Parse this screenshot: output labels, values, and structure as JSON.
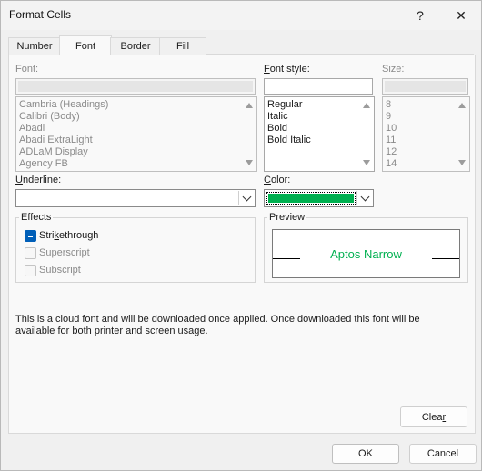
{
  "window": {
    "title": "Format Cells",
    "help_label": "?",
    "close_label": "✕"
  },
  "tabs": [
    {
      "label": "Number",
      "active": false
    },
    {
      "label": "Font",
      "active": true
    },
    {
      "label": "Border",
      "active": false
    },
    {
      "label": "Fill",
      "active": false
    }
  ],
  "font": {
    "label": "Font:",
    "value": "",
    "items": [
      "Cambria (Headings)",
      "Calibri (Body)",
      "Abadi",
      "Abadi ExtraLight",
      "ADLaM Display",
      "Agency FB"
    ]
  },
  "font_style": {
    "label_pre": "F",
    "label_rest": "ont style:",
    "value": "",
    "items": [
      "Regular",
      "Italic",
      "Bold",
      "Bold Italic"
    ]
  },
  "size": {
    "label": "Size:",
    "value": "",
    "items": [
      "8",
      "9",
      "10",
      "11",
      "12",
      "14"
    ]
  },
  "underline": {
    "label_pre": "U",
    "label_rest": "nderline:",
    "value": ""
  },
  "color": {
    "label_pre": "C",
    "label_rest": "olor:",
    "swatch": "#00b050"
  },
  "effects": {
    "title": "Effects",
    "strikethrough": {
      "label_a": "Stri",
      "label_k": "k",
      "label_b": "ethrough",
      "checked": true
    },
    "superscript": {
      "label": "Superscript",
      "checked": false
    },
    "subscript": {
      "label": "Subscript",
      "checked": false
    }
  },
  "preview": {
    "title": "Preview",
    "text": "Aptos Narrow",
    "color": "#00b050"
  },
  "info_line1": "This is a cloud font and will be downloaded once applied. Once downloaded this font will be",
  "info_line2": "available for both printer and screen usage.",
  "buttons": {
    "clear_pre": "Clea",
    "clear_k": "r",
    "ok": "OK",
    "cancel": "Cancel"
  }
}
